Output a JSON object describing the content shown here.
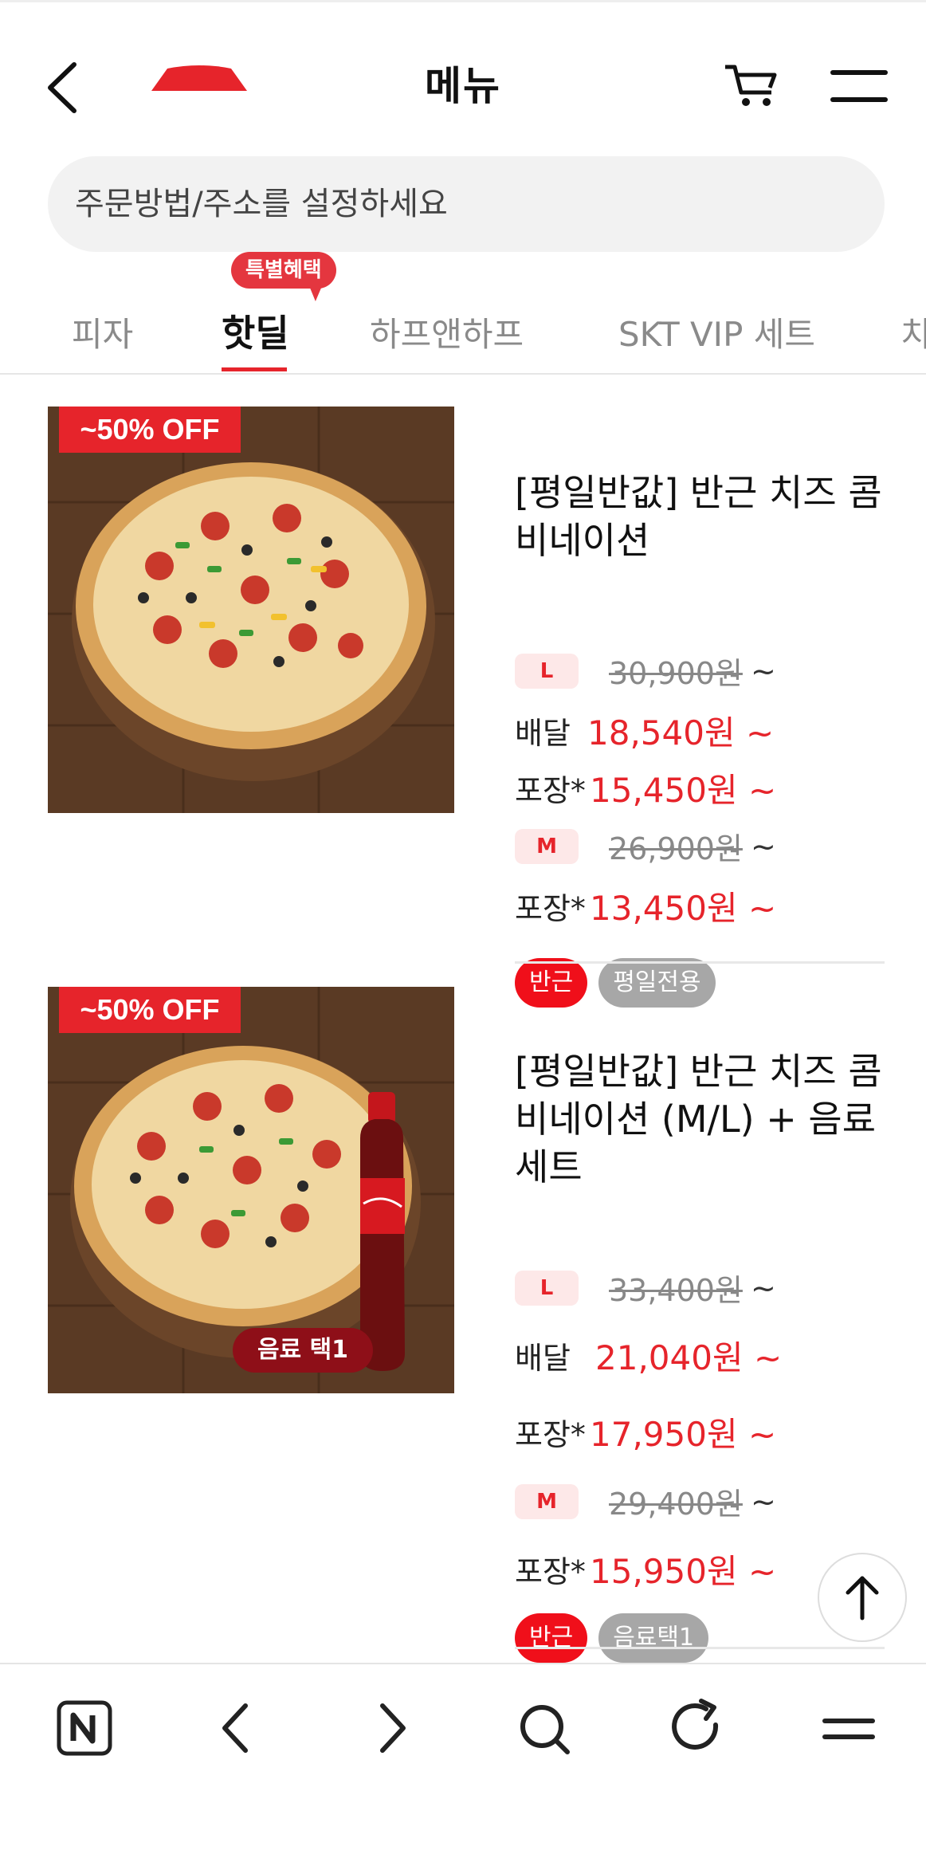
{
  "header": {
    "title": "메뉴",
    "back_icon": "chevron-left-icon",
    "cart_icon": "cart-icon",
    "menu_icon": "hamburger-icon"
  },
  "address": {
    "placeholder": "주문방법/주소를 설정하세요"
  },
  "tabs": {
    "badge": "특별혜택",
    "items": [
      {
        "label": "피자",
        "active": false
      },
      {
        "label": "핫딜",
        "active": true
      },
      {
        "label": "하프앤하프",
        "active": false
      },
      {
        "label": "SKT VIP 세트",
        "active": false
      },
      {
        "label": "치",
        "active": false
      }
    ]
  },
  "products": [
    {
      "off_tag": "~50% OFF",
      "name": "[평일반값] 반근 치즈 콤비네이션",
      "sizes": [
        {
          "size": "L",
          "original_price": "30,900원",
          "tilde": "~",
          "rows": [
            {
              "label": "배달",
              "price": "18,540원 ~"
            },
            {
              "label": "포장*",
              "price": "15,450원 ~"
            }
          ]
        },
        {
          "size": "M",
          "original_price": "26,900원",
          "tilde": "~",
          "rows": [
            {
              "label": "포장*",
              "price": "13,450원 ~"
            }
          ]
        }
      ],
      "chips": [
        "반근",
        "평일전용"
      ]
    },
    {
      "off_tag": "~50% OFF",
      "drink_tag": "음료 택1",
      "name": "[평일반값] 반근 치즈 콤비네이션 (M/L) + 음료 세트",
      "sizes": [
        {
          "size": "L",
          "original_price": "33,400원",
          "tilde": "~",
          "rows": [
            {
              "label": "배달",
              "price": "21,040원 ~"
            },
            {
              "label": "포장*",
              "price": "17,950원 ~"
            }
          ]
        },
        {
          "size": "M",
          "original_price": "29,400원",
          "tilde": "~",
          "rows": [
            {
              "label": "포장*",
              "price": "15,950원 ~"
            }
          ]
        }
      ],
      "chips": [
        "반근",
        "음료택1"
      ]
    }
  ],
  "colors": {
    "accent": "#e6242b",
    "chip_gray": "#a7a7a7"
  },
  "bottom_bar": [
    "naver-icon",
    "back-icon",
    "forward-icon",
    "search-icon",
    "refresh-icon",
    "menu-icon"
  ]
}
